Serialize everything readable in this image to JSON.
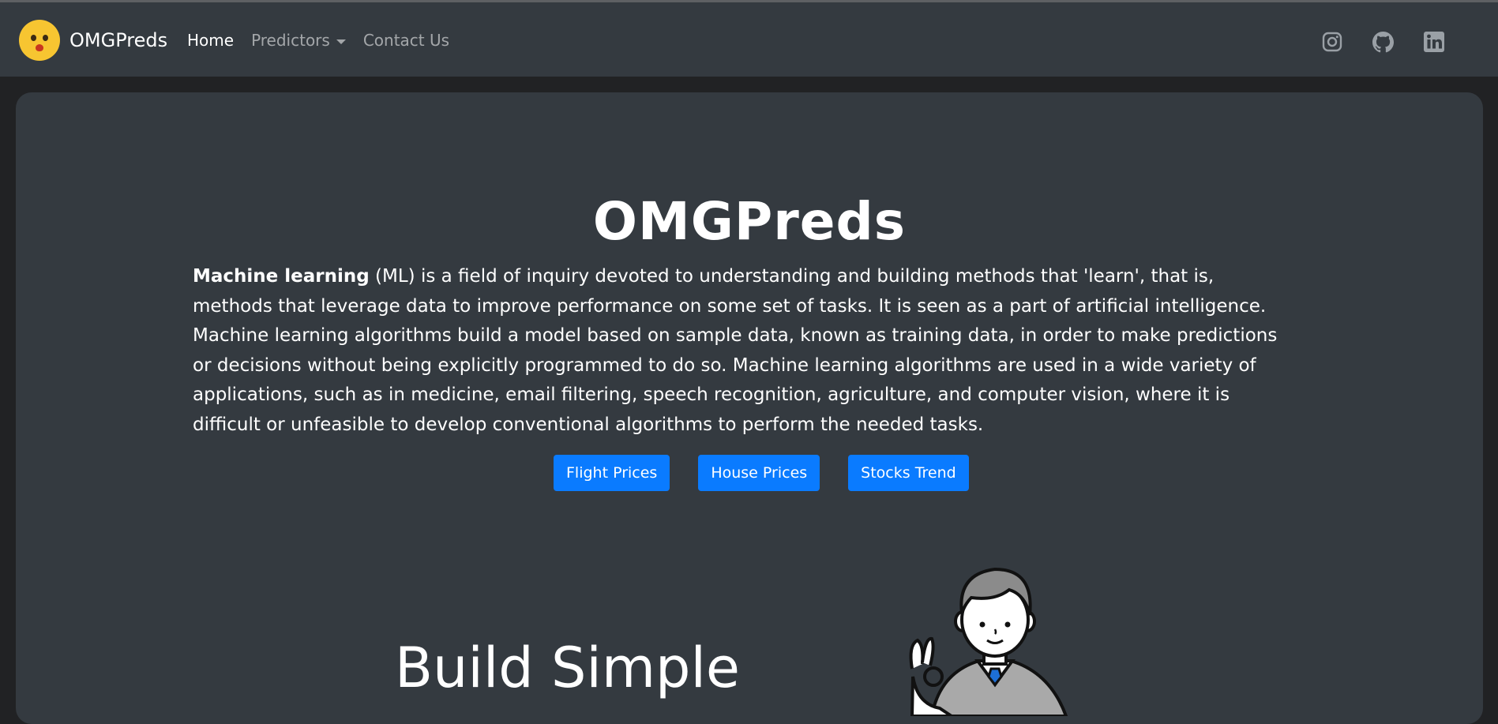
{
  "navbar": {
    "brand": "OMGPreds",
    "links": [
      {
        "label": "Home",
        "active": true
      },
      {
        "label": "Predictors",
        "dropdown": true
      },
      {
        "label": "Contact Us"
      }
    ],
    "social_icons": [
      "instagram-icon",
      "github-icon",
      "linkedin-icon"
    ]
  },
  "hero": {
    "title": "OMGPreds",
    "lead_bold": "Machine learning",
    "lead_rest": " (ML) is a field of inquiry devoted to understanding and building methods that 'learn', that is, methods that leverage data to improve performance on some set of tasks. It is seen as a part of artificial intelligence. Machine learning algorithms build a model based on sample data, known as training data, in order to make predictions or decisions without being explicitly programmed to do so. Machine learning algorithms are used in a wide variety of applications, such as in medicine, email filtering, speech recognition, agriculture, and computer vision, where it is difficult or unfeasible to develop conventional algorithms to perform the needed tasks.",
    "buttons": [
      "Flight Prices",
      "House Prices",
      "Stocks Trend"
    ]
  },
  "section": {
    "title": "Build Simple"
  },
  "colors": {
    "navbar_bg": "#343a40",
    "page_bg": "#212224",
    "button_blue": "#0a7bff"
  }
}
